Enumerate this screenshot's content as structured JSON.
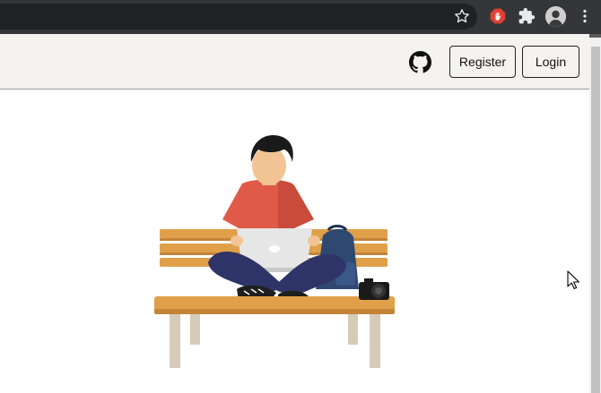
{
  "browser": {
    "icons": [
      "star-icon",
      "adblock-extension-icon",
      "puzzle-extensions-icon",
      "profile-avatar",
      "kebab-menu-icon"
    ],
    "colors": {
      "toolbar": "#35363a",
      "omnibox": "#202124",
      "adblock": "#e04035"
    }
  },
  "header": {
    "github_icon": "github-icon",
    "register_label": "Register",
    "login_label": "Login",
    "background": "#f4f3ef"
  },
  "hero": {
    "illustration": "person-with-laptop-on-bench",
    "colors": {
      "bench": "#e0a04a",
      "shirt": "#e05a48",
      "pants": "#2f3468",
      "backpack": "#2e4870",
      "hair": "#1a1a1a",
      "skin": "#f2c494",
      "laptop": "#e6e6e6"
    }
  }
}
